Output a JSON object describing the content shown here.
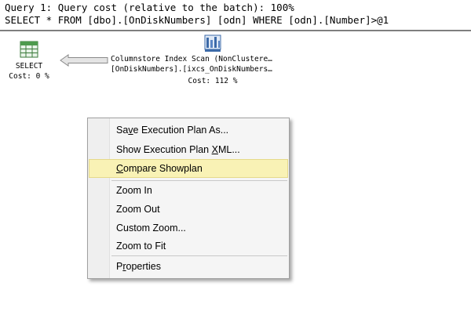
{
  "header": {
    "line1": "Query 1: Query cost (relative to the batch): 100%",
    "line2": "SELECT * FROM [dbo].[OnDiskNumbers] [odn] WHERE [odn].[Number]>@1"
  },
  "plan": {
    "select_node": {
      "icon": "table-icon",
      "label": "SELECT",
      "cost": "Cost: 0 %"
    },
    "scan_node": {
      "icon": "columnstore-index-scan-icon",
      "line1": "Columnstore Index Scan (NonClustere…",
      "line2": "[OnDiskNumbers].[ixcs_OnDiskNumbers…",
      "cost": "Cost: 112 %"
    },
    "arrow_icon": "data-flow-arrow"
  },
  "context_menu": {
    "items": [
      {
        "pre": "Sa",
        "accel": "v",
        "post": "e Execution Plan As..."
      },
      {
        "pre": "Show Execution Plan ",
        "accel": "X",
        "post": "ML..."
      },
      {
        "pre": "",
        "accel": "C",
        "post": "ompare Showplan"
      },
      {
        "pre": "Zoom In",
        "accel": "",
        "post": ""
      },
      {
        "pre": "Zoom Out",
        "accel": "",
        "post": ""
      },
      {
        "pre": "Custom Zoom...",
        "accel": "",
        "post": ""
      },
      {
        "pre": "Zoom to Fit",
        "accel": "",
        "post": ""
      },
      {
        "pre": "P",
        "accel": "r",
        "post": "operties"
      }
    ],
    "highlight_color": "#f9f2b5"
  }
}
